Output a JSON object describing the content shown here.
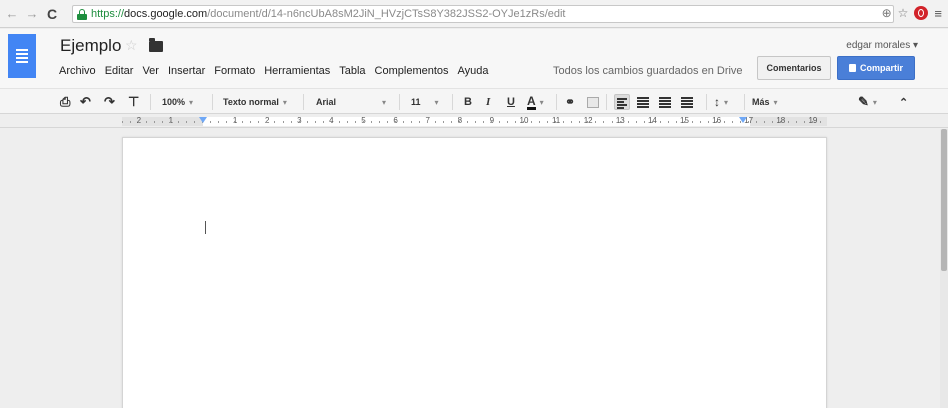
{
  "browser": {
    "url_https": "https://",
    "url_domain": "docs.google.com",
    "url_path": "/document/d/14-n6ncUbA8sM2JiN_HVzjCTsS8Y382JSS2-OYJe1zRs/edit"
  },
  "doc": {
    "title": "Ejemplo",
    "status": "Todos los cambios guardados en Drive",
    "user": "edgar morales ▾"
  },
  "menu": [
    "Archivo",
    "Editar",
    "Ver",
    "Insertar",
    "Formato",
    "Herramientas",
    "Tabla",
    "Complementos",
    "Ayuda"
  ],
  "buttons": {
    "comments": "Comentarios",
    "share": "Compartir"
  },
  "toolbar": {
    "zoom": "100%",
    "style": "Texto normal",
    "font": "Arial",
    "size": "11",
    "bold": "B",
    "italic": "I",
    "underline": "U",
    "text_color": "A",
    "more": "Más"
  },
  "ruler": {
    "left_numbers": [
      "2",
      "1"
    ],
    "numbers": [
      "1",
      "2",
      "3",
      "4",
      "5",
      "6",
      "7",
      "8",
      "9",
      "10",
      "11",
      "12",
      "13",
      "14",
      "15",
      "16",
      "17",
      "18",
      "19"
    ]
  },
  "colors": {
    "docs_blue": "#4285f4",
    "share_blue": "#4a7fd8",
    "lock_green": "#1e8e3e"
  }
}
